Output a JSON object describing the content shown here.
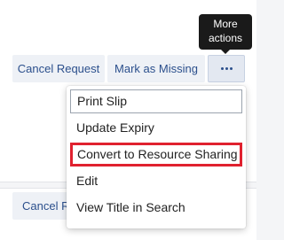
{
  "tooltip": {
    "text_line1": "More",
    "text_line2": "actions"
  },
  "actions": {
    "cancel_request_label": "Cancel Request",
    "mark_missing_label": "Mark as Missing",
    "more_icon": "ellipsis-icon",
    "cancel_request_truncated": "Cancel Re"
  },
  "menu": {
    "items": [
      {
        "label": "Print Slip",
        "state": "focused"
      },
      {
        "label": "Update Expiry",
        "state": "normal"
      },
      {
        "label": "Convert to Resource Sharing",
        "state": "highlighted"
      },
      {
        "label": "Edit",
        "state": "normal"
      },
      {
        "label": "View Title in Search",
        "state": "normal"
      }
    ]
  },
  "colors": {
    "highlight_border": "#e0212f",
    "button_text": "#2b4f8c",
    "tooltip_bg": "#1a1a1a"
  }
}
